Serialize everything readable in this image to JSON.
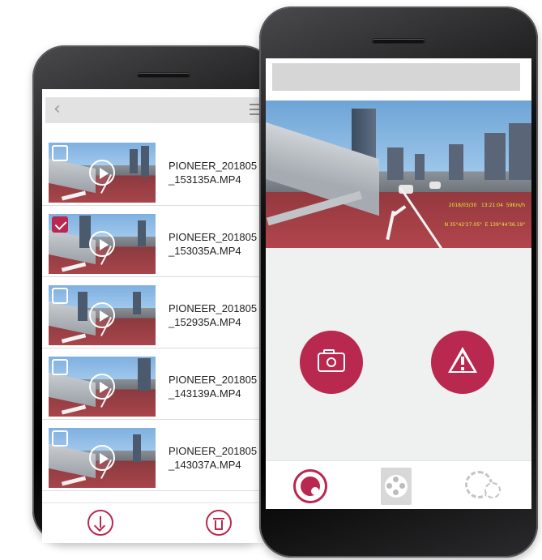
{
  "colors": {
    "accent": "#b8284f",
    "tab_inactive": "#c4c4c4"
  },
  "file_list_screen": {
    "back_icon": "chevron-left-icon",
    "back_glyph": "‹",
    "menu_icon": "menu-icon",
    "files": [
      {
        "name_line1": "PIONEER_201805",
        "name_line2": "_153135A.MP4",
        "checked": false
      },
      {
        "name_line1": "PIONEER_201805",
        "name_line2": "_153035A.MP4",
        "checked": true
      },
      {
        "name_line1": "PIONEER_201805",
        "name_line2": "_152935A.MP4",
        "checked": false
      },
      {
        "name_line1": "PIONEER_201805",
        "name_line2": "_143139A.MP4",
        "checked": false
      },
      {
        "name_line1": "PIONEER_201805",
        "name_line2": "_143037A.MP4",
        "checked": false
      }
    ],
    "bottom_actions": {
      "download_icon": "download-icon",
      "delete_icon": "trash-icon"
    }
  },
  "camera_screen": {
    "live_view_overlay": {
      "line1": "2018/03/30   13:21:04  59Km/h",
      "line2": "N 35°42'27.05\"  E 139°44'36.19\""
    },
    "actions": {
      "snapshot_icon": "camera-icon",
      "event_record_icon": "warning-icon"
    },
    "tabs": [
      {
        "icon": "live-camera-icon",
        "active": true
      },
      {
        "icon": "film-file-icon",
        "active": false
      },
      {
        "icon": "settings-gear-icon",
        "active": false
      }
    ]
  }
}
